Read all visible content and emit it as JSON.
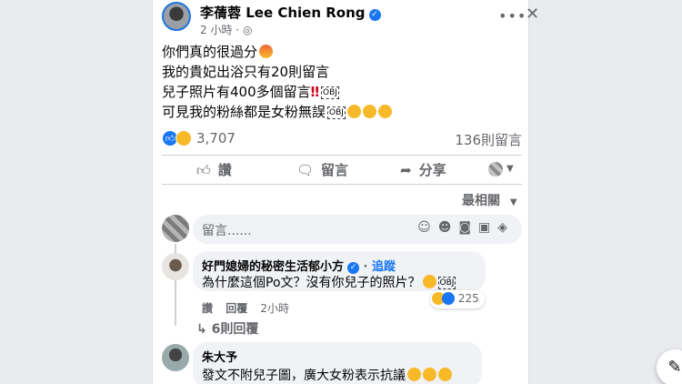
{
  "post": {
    "author": "李蒨蓉 Lee Chien Rong",
    "time": "2 小時",
    "privacy_glyph": "·",
    "lines": [
      "你們真的很過分",
      "我的貴妃出浴只有20則留言",
      "兒子照片有400多個留言",
      "可見我的粉絲都是女粉無誤"
    ],
    "bang": "‼",
    "obj_label": "OBJ",
    "reactions_count": "3,707",
    "comments_count": "136則留言"
  },
  "actions": {
    "like": "讚",
    "comment": "留言",
    "share": "分享"
  },
  "sort_label": "最相關",
  "composer": {
    "placeholder": "留言......"
  },
  "comments": [
    {
      "author": "好門媳婦的秘密生活郁小方",
      "follow": "追蹤",
      "text": "為什麼這個Po文？沒有你兒子的照片？",
      "like": "讚",
      "reply": "回覆",
      "time": "2小時",
      "reaction_count": "225",
      "replies": "6則回覆"
    },
    {
      "author": "朱大予",
      "text": "發文不附兒子圖，廣大女粉表示抗議"
    }
  ],
  "icons": {
    "more": "more-icon",
    "close": "close-icon",
    "verified": "verified-icon",
    "like": "thumbs-up-icon",
    "comment": "speech-bubble-icon",
    "share": "share-arrow-icon",
    "edit": "edit-icon"
  },
  "colors": {
    "accent": "#1877f2",
    "text_secondary": "#65676b",
    "bubble": "#f0f2f5"
  }
}
